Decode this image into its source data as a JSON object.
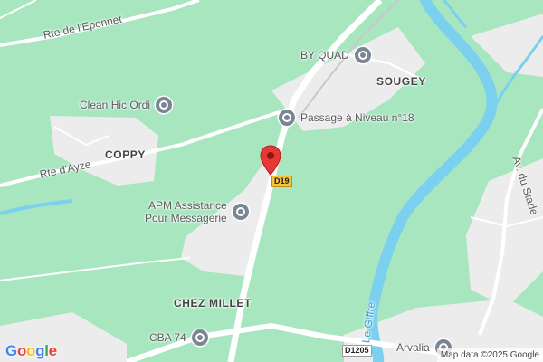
{
  "map": {
    "pin_color": "#e53935",
    "water_color": "#7ad0ee",
    "green_color": "#a8e6c0",
    "built_color": "#ececec",
    "road_color": "#ffffff"
  },
  "roads": {
    "eponnet": "Rte de l'Eponnet",
    "ayze": "Rte d'Ayze",
    "stade": "Av. du Stade",
    "giffre": "Le Giffre"
  },
  "places": {
    "sougey": "SOUGEY",
    "coppy": "COPPY",
    "chez_millet": "CHEZ MILLET"
  },
  "pois": {
    "by_quad": "BY QUAD",
    "clean_hic": "Clean Hic Ordi",
    "passage": "Passage à Niveau n°18",
    "apm_line1": "APM Assistance",
    "apm_line2": "Pour Messagerie",
    "cba": "CBA 74",
    "arvalia": "Arvalia"
  },
  "shields": {
    "d19": "D19",
    "d1205": "D1205"
  },
  "branding": {
    "google_letters": [
      "G",
      "o",
      "o",
      "g",
      "l",
      "e"
    ],
    "attribution": "Map data ©2025 Google"
  }
}
